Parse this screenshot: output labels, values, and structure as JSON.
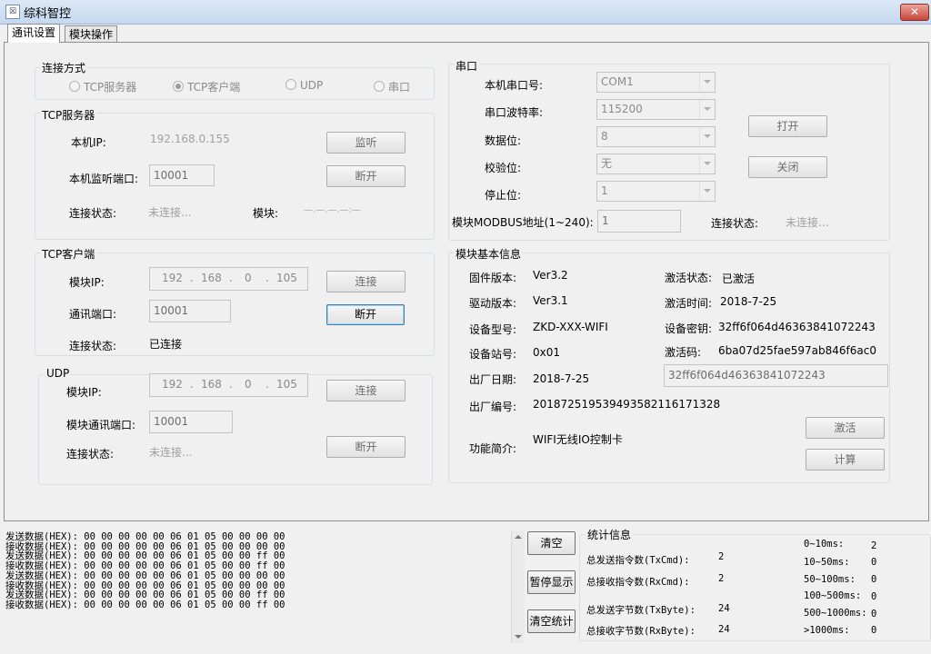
{
  "window": {
    "title": "综科智控",
    "close_glyph": "✕"
  },
  "tabs": [
    {
      "label": "通讯设置",
      "active": true
    },
    {
      "label": "模块操作",
      "active": false
    }
  ],
  "connection_mode": {
    "legend": "连接方式",
    "options": [
      "TCP服务器",
      "TCP客户端",
      "UDP",
      "串口"
    ],
    "selected": "TCP客户端"
  },
  "tcp_server": {
    "legend": "TCP服务器",
    "ip_label": "本机IP:",
    "ip_value": "192.168.0.155",
    "port_label": "本机监听端口:",
    "port_value": "10001",
    "status_label": "连接状态:",
    "status_value": "未连接...",
    "module_label": "模块:",
    "module_value": "—.—.—.—:—",
    "listen_btn": "监听",
    "disconnect_btn": "断开"
  },
  "tcp_client": {
    "legend": "TCP客户端",
    "ip_label": "模块IP:",
    "ip": [
      "192",
      "168",
      "0",
      "105"
    ],
    "port_label": "通讯端口:",
    "port_value": "10001",
    "status_label": "连接状态:",
    "status_value": "已连接",
    "connect_btn": "连接",
    "disconnect_btn": "断开"
  },
  "udp": {
    "legend": "UDP",
    "ip_label": "模块IP:",
    "ip": [
      "192",
      "168",
      "0",
      "105"
    ],
    "port_label": "模块通讯端口:",
    "port_value": "10001",
    "status_label": "连接状态:",
    "status_value": "未连接...",
    "connect_btn": "连接",
    "disconnect_btn": "断开"
  },
  "serial": {
    "legend": "串口",
    "port_label": "本机串口号:",
    "port_value": "COM1",
    "baud_label": "串口波特率:",
    "baud_value": "115200",
    "data_bits_label": "数据位:",
    "data_bits_value": "8",
    "parity_label": "校验位:",
    "parity_value": "无",
    "stop_bits_label": "停止位:",
    "stop_bits_value": "1",
    "open_btn": "打开",
    "close_btn": "关闭",
    "modbus_label": "模块MODBUS地址(1~240):",
    "modbus_value": "1",
    "status_label": "连接状态:",
    "status_value": "未连接..."
  },
  "module_info": {
    "legend": "模块基本信息",
    "firmware_label": "固件版本:",
    "firmware_value": "Ver3.2",
    "driver_label": "驱动版本:",
    "driver_value": "Ver3.1",
    "model_label": "设备型号:",
    "model_value": "ZKD-XXX-WIFI",
    "station_label": "设备站号:",
    "station_value": "0x01",
    "date_label": "出厂日期:",
    "date_value": "2018-7-25",
    "serial_label": "出厂编号:",
    "serial_value": "20187251953949358211617132​8",
    "func_label": "功能简介:",
    "func_value": "WIFI无线IO控制卡",
    "act_status_label": "激活状态:",
    "act_status_value": "已激活",
    "act_time_label": "激活时间:",
    "act_time_value": "2018-7-25",
    "device_key_label": "设备密钥:",
    "device_key_value": "32ff6f064d46363841072243",
    "act_code_label": "激活码:",
    "act_code_value": "6ba07d25fae597ab846f6ac0",
    "key_input_value": "32ff6f064d46363841072243",
    "activate_btn": "激活",
    "calc_btn": "计算"
  },
  "log_lines": [
    "发送数据(HEX): 00 00 00 00 00 06 01 05 00 00 00 00",
    "接收数据(HEX): 00 00 00 00 00 06 01 05 00 00 00 00",
    "发送数据(HEX): 00 00 00 00 00 06 01 05 00 00 ff 00",
    "接收数据(HEX): 00 00 00 00 00 06 01 05 00 00 ff 00",
    "发送数据(HEX): 00 00 00 00 00 06 01 05 00 00 00 00",
    "接收数据(HEX): 00 00 00 00 00 06 01 05 00 00 00 00",
    "发送数据(HEX): 00 00 00 00 00 06 01 05 00 00 ff 00",
    "接收数据(HEX): 00 00 00 00 00 06 01 05 00 00 ff 00"
  ],
  "log_buttons": {
    "clear": "清空",
    "pause": "暂停显示",
    "clear_stats": "清空统计"
  },
  "stats": {
    "legend": "统计信息",
    "tx_cmd_label": "总发送指令数(TxCmd):",
    "tx_cmd": "2",
    "rx_cmd_label": "总接收指令数(RxCmd):",
    "rx_cmd": "2",
    "tx_byte_label": "总发送字节数(TxByte):",
    "tx_byte": "24",
    "rx_byte_label": "总接收字节数(RxByte):",
    "rx_byte": "24",
    "ranges": [
      {
        "label": "0~10ms:",
        "value": "2"
      },
      {
        "label": "10~50ms:",
        "value": "0"
      },
      {
        "label": "50~100ms:",
        "value": "0"
      },
      {
        "label": "100~500ms:",
        "value": "0"
      },
      {
        "label": "500~1000ms:",
        "value": "0"
      },
      {
        "label": ">1000ms:",
        "value": "0"
      }
    ]
  }
}
